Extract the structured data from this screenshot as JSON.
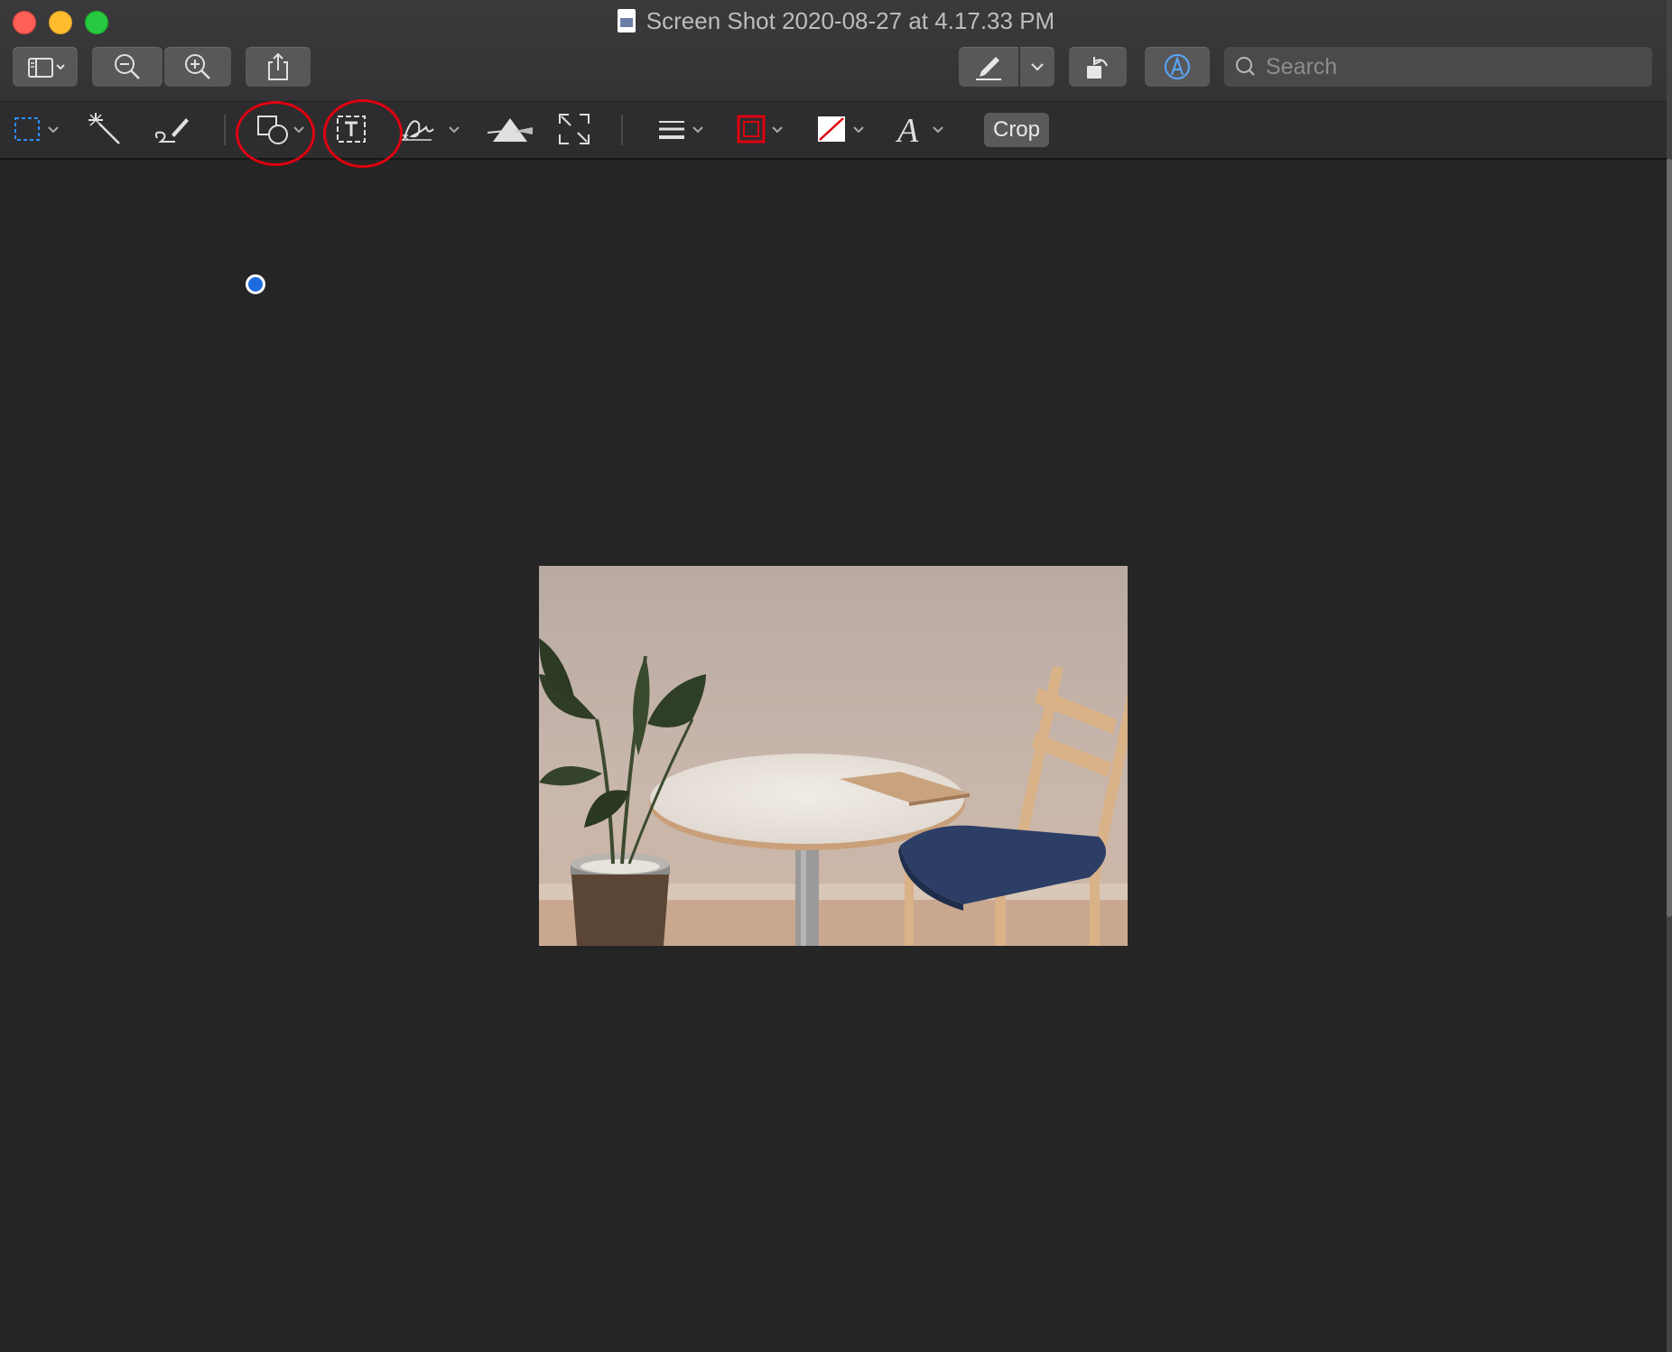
{
  "window": {
    "title": "Screen Shot 2020-08-27 at 4.17.33 PM"
  },
  "toolbar": {
    "sidebar_icon": "sidebar-icon",
    "zoom_out_icon": "zoom-out-icon",
    "zoom_in_icon": "zoom-in-icon",
    "share_icon": "share-icon",
    "highlight_icon": "highlighter-icon",
    "rotate_icon": "rotate-icon",
    "markup_icon": "markup-icon"
  },
  "search": {
    "placeholder": "Search"
  },
  "markup": {
    "crop_label": "Crop",
    "tools": [
      "rectangular-selection",
      "instant-alpha",
      "sketch",
      "shapes",
      "text",
      "sign",
      "adjust-color",
      "adjust-size",
      "shape-style",
      "border-color",
      "fill-color",
      "text-style"
    ]
  },
  "annotations": {
    "circle_color": "#e0000f",
    "circled_tools": [
      "shapes",
      "text"
    ]
  },
  "colors": {
    "accent": "#1e6be0",
    "background": "#252525"
  }
}
